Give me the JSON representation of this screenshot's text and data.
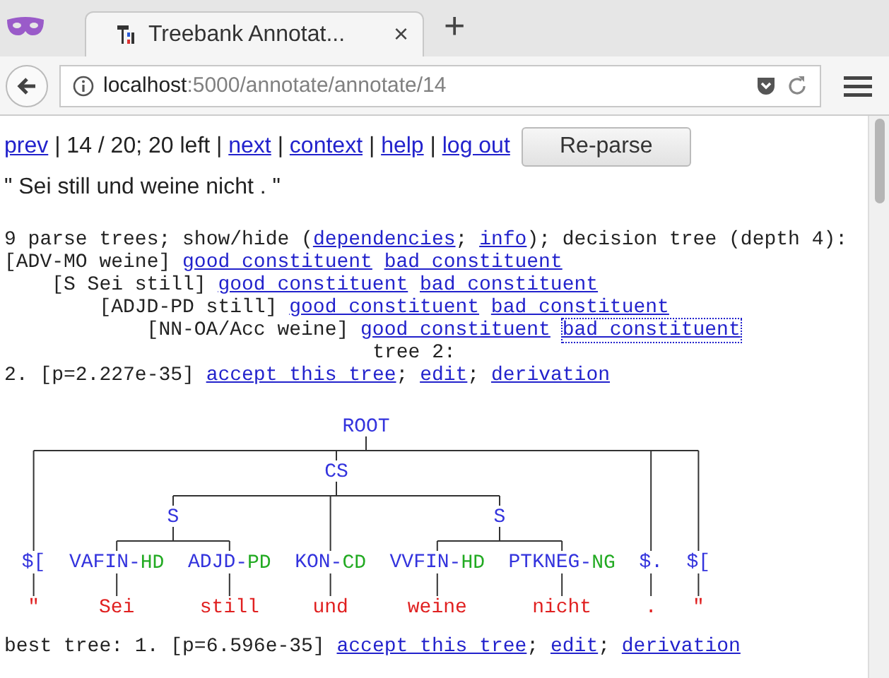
{
  "browser": {
    "tab_title": "Treebank Annotat...",
    "close": "×",
    "new_tab": "+",
    "url_host": "localhost",
    "url_path": ":5000/annotate/annotate/14"
  },
  "nav": [
    {
      "text": "prev",
      "kind": "link"
    },
    {
      "text": " | 14 / 20; 20 left | ",
      "kind": "text"
    },
    {
      "text": "next",
      "kind": "link"
    },
    {
      "text": " | ",
      "kind": "text"
    },
    {
      "text": "context",
      "kind": "link"
    },
    {
      "text": " | ",
      "kind": "text"
    },
    {
      "text": "help",
      "kind": "link"
    },
    {
      "text": " | ",
      "kind": "text"
    },
    {
      "text": "log out",
      "kind": "link"
    }
  ],
  "reparse_button": "Re-parse",
  "sentence": "\" Sei still und weine nicht . \"",
  "summary": [
    {
      "text": "9 parse trees; show/hide (",
      "kind": "text"
    },
    {
      "text": "dependencies",
      "kind": "link"
    },
    {
      "text": "; ",
      "kind": "text"
    },
    {
      "text": "info",
      "kind": "link"
    },
    {
      "text": "); decision tree (depth 4):",
      "kind": "text"
    }
  ],
  "decision_tree": [
    {
      "label": "[ADV-MO weine]",
      "good": "good constituent",
      "bad": "bad constituent",
      "bad_focused": false,
      "children": [
        {
          "label": "[S Sei still]",
          "good": "good constituent",
          "bad": "bad constituent",
          "bad_focused": false,
          "children": [
            {
              "label": "[ADJD-PD still]",
              "good": "good constituent",
              "bad": "bad constituent",
              "bad_focused": false,
              "children": [
                {
                  "label": "[NN-OA/Acc weine]",
                  "good": "good constituent",
                  "bad": "bad constituent",
                  "bad_focused": true
                }
              ]
            }
          ]
        }
      ]
    }
  ],
  "tree_caption": "tree 2:",
  "candidate": [
    {
      "text": "2. [p=2.227e-35] ",
      "kind": "text"
    },
    {
      "text": "accept this tree",
      "kind": "link"
    },
    {
      "text": "; ",
      "kind": "text"
    },
    {
      "text": "edit",
      "kind": "link"
    },
    {
      "text": "; ",
      "kind": "text"
    },
    {
      "text": "derivation",
      "kind": "link"
    }
  ],
  "parse_tree": {
    "label": "ROOT",
    "children": [
      {
        "label": "$[",
        "word": "\""
      },
      {
        "label": "CS",
        "children": [
          {
            "label": "S",
            "children": [
              {
                "label": "VAFIN",
                "separator": "-",
                "function": "HD",
                "word": "Sei"
              },
              {
                "label": "ADJD",
                "separator": "-",
                "function": "PD",
                "word": "still"
              }
            ]
          },
          {
            "label": "KON",
            "separator": "-",
            "function": "CD",
            "word": "und"
          },
          {
            "label": "S",
            "children": [
              {
                "label": "VVFIN",
                "separator": "-",
                "function": "HD",
                "word": "weine"
              },
              {
                "label": "PTKNEG",
                "separator": "-",
                "function": "NG",
                "word": "nicht"
              }
            ]
          }
        ]
      },
      {
        "label": "$.",
        "word": "."
      },
      {
        "label": "$[",
        "word": "\""
      }
    ]
  },
  "best": [
    {
      "text": "best tree: 1. [p=6.596e-35] ",
      "kind": "text"
    },
    {
      "text": "accept this tree",
      "kind": "link"
    },
    {
      "text": "; ",
      "kind": "text"
    },
    {
      "text": "edit",
      "kind": "link"
    },
    {
      "text": "; ",
      "kind": "text"
    },
    {
      "text": "derivation",
      "kind": "link"
    }
  ]
}
